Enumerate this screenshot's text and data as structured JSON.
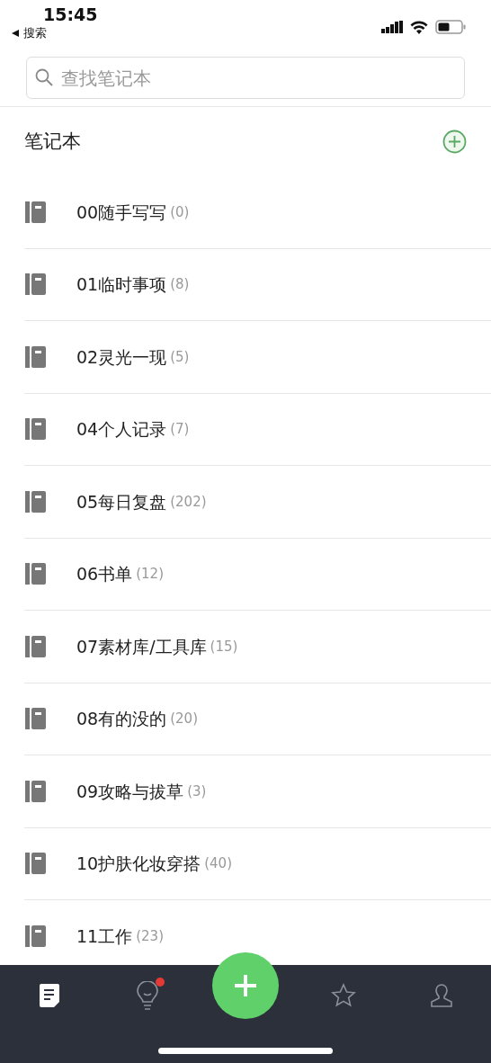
{
  "status_bar": {
    "time": "15:45",
    "back_label": "搜索"
  },
  "search": {
    "placeholder": "查找笔记本"
  },
  "section": {
    "title": "笔记本"
  },
  "notebooks": [
    {
      "name": "00随手写写",
      "count": "(0)"
    },
    {
      "name": "01临时事项",
      "count": "(8)"
    },
    {
      "name": "02灵光一现",
      "count": "(5)"
    },
    {
      "name": "04个人记录",
      "count": "(7)"
    },
    {
      "name": "05每日复盘",
      "count": "(202)"
    },
    {
      "name": "06书单",
      "count": "(12)"
    },
    {
      "name": "07素材库/工具库",
      "count": "(15)"
    },
    {
      "name": "08有的没的",
      "count": "(20)"
    },
    {
      "name": "09攻略与拔草",
      "count": "(3)"
    },
    {
      "name": "10护肤化妆穿搭",
      "count": "(40)"
    },
    {
      "name": "11工作",
      "count": "(23)"
    }
  ],
  "tab_bar": [
    {
      "kind": "notes",
      "selected": true,
      "badge": false
    },
    {
      "kind": "ideas",
      "selected": false,
      "badge": true
    },
    {
      "kind": "add",
      "selected": false,
      "badge": false
    },
    {
      "kind": "favorites",
      "selected": false,
      "badge": false
    },
    {
      "kind": "profile",
      "selected": false,
      "badge": false
    }
  ]
}
